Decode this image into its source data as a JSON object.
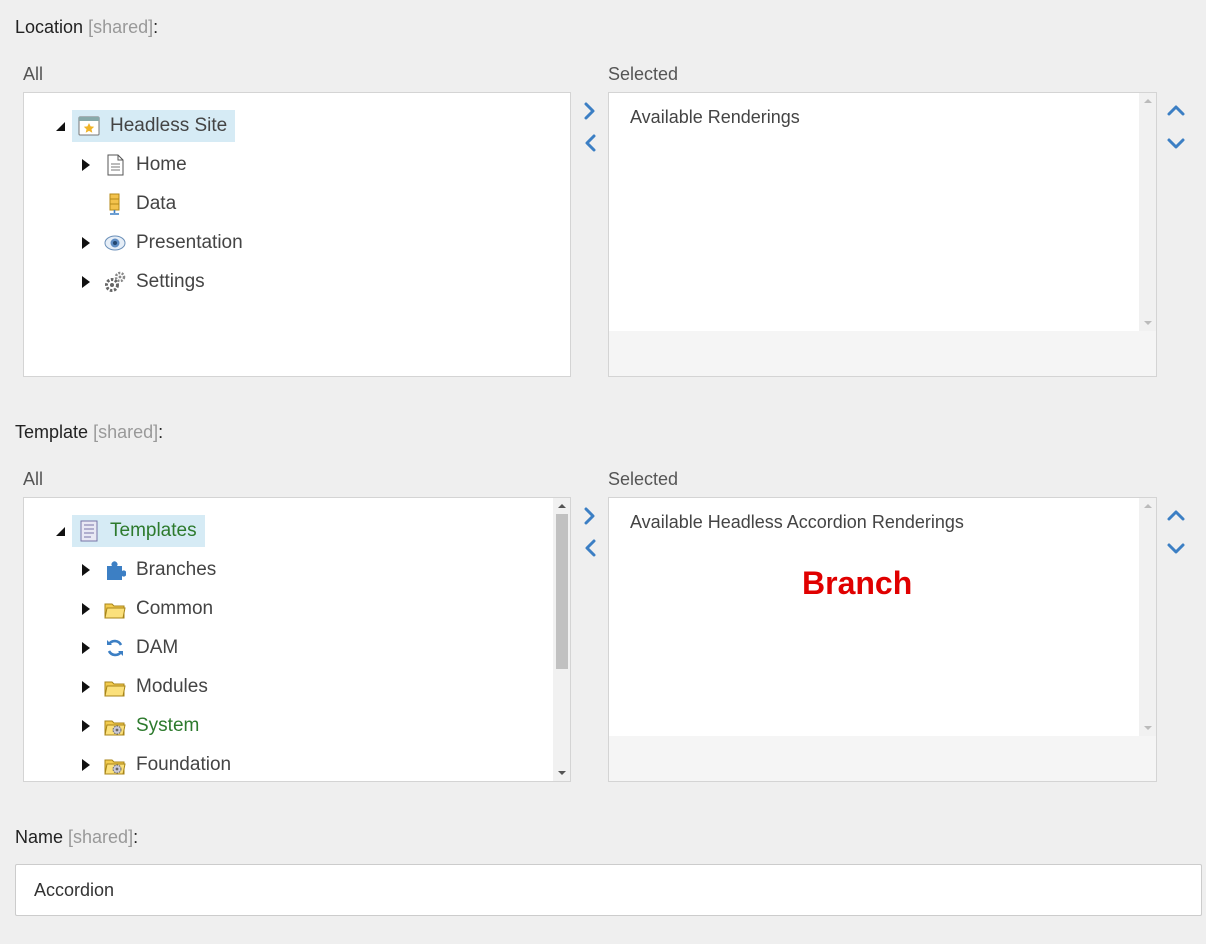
{
  "location": {
    "label": "Location",
    "shared": "[shared]",
    "colon": ":",
    "all_label": "All",
    "selected_label": "Selected",
    "tree": {
      "root": "Headless Site",
      "children": [
        "Home",
        "Data",
        "Presentation",
        "Settings"
      ]
    },
    "selected_items": [
      "Available Renderings"
    ]
  },
  "template": {
    "label": "Template",
    "shared": "[shared]",
    "colon": ":",
    "all_label": "All",
    "selected_label": "Selected",
    "tree": {
      "root": "Templates",
      "children": [
        "Branches",
        "Common",
        "DAM",
        "Modules",
        "System",
        "Foundation"
      ]
    },
    "selected_items": [
      "Available Headless Accordion Renderings"
    ],
    "annotation": "Branch"
  },
  "name": {
    "label": "Name",
    "shared": "[shared]",
    "colon": ":",
    "value": "Accordion"
  },
  "icons": {
    "headless_site": "site-window-icon",
    "home": "document-icon",
    "data": "data-icon",
    "presentation": "eye-icon",
    "settings": "gears-icon",
    "templates": "template-list-icon",
    "branches": "puzzle-icon",
    "common": "folder-icon",
    "dam": "sync-icon",
    "modules": "folder-icon",
    "system": "folder-gear-icon",
    "foundation": "folder-gear-icon"
  },
  "colors": {
    "accent": "#3c7fc4",
    "root_highlight": "#d6ebf5",
    "annotation": "#e00000",
    "green_text": "#2d7a2d"
  }
}
